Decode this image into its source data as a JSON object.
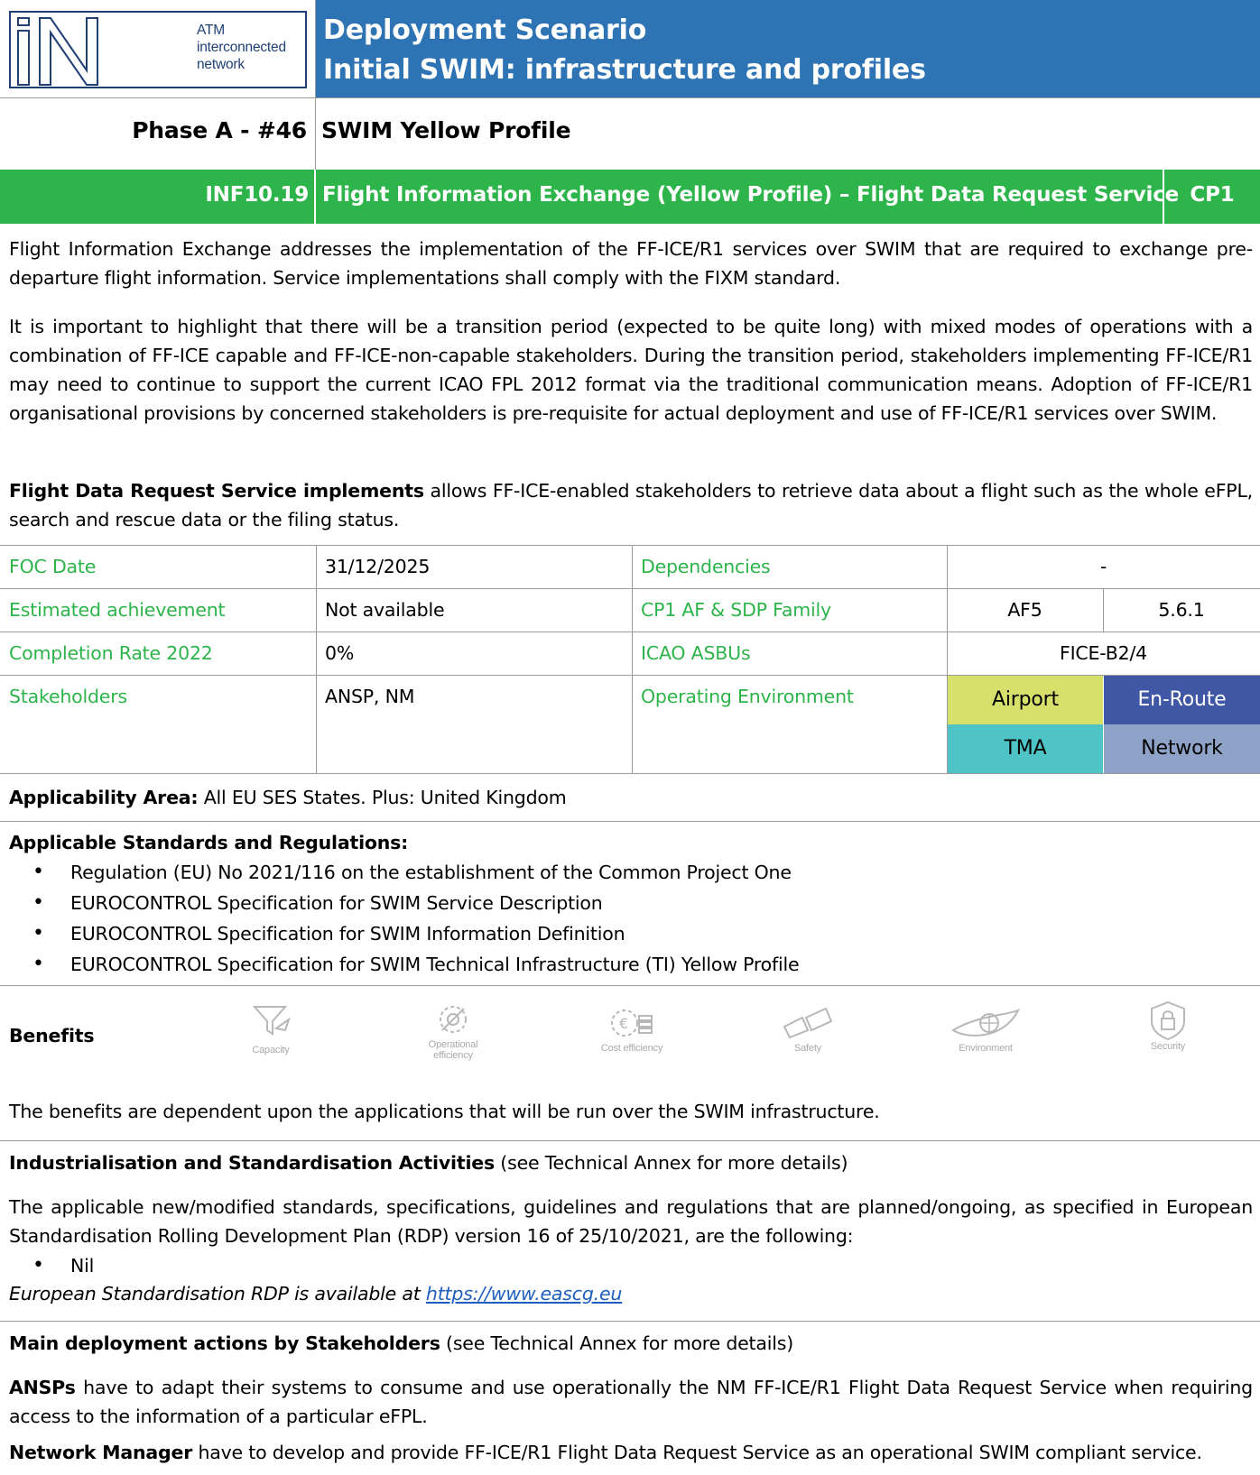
{
  "header": {
    "logo_letters": "iN",
    "logo_text": [
      "ATM",
      "interconnected",
      "network"
    ],
    "title_line1": "Deployment Scenario",
    "title_line2": "Initial SWIM: infrastructure and profiles"
  },
  "phase": {
    "left": "Phase A - #46",
    "right": "SWIM Yellow Profile"
  },
  "item": {
    "code": "INF10.19",
    "title": "Flight Information Exchange (Yellow Profile) – Flight Data Request Service",
    "cp": "CP1"
  },
  "description": {
    "p1": "Flight Information Exchange addresses the implementation of the FF-ICE/R1 services over SWIM that are required to exchange pre-departure flight information. Service implementations shall comply with the FIXM standard.",
    "p2": "It is important to highlight that there will be a transition period (expected to be quite long) with mixed modes of operations with a combination of FF-ICE capable and FF-ICE-non-capable stakeholders. During the transition period, stakeholders implementing FF-ICE/R1 may need to continue to support the current ICAO FPL 2012 format via the traditional communication means. Adoption of FF-ICE/R1 organisational provisions by concerned stakeholders is pre-requisite for actual deployment and use of FF-ICE/R1 services over SWIM.",
    "p3_bold": "Flight Data Request Service implements",
    "p3_rest": " allows FF-ICE-enabled stakeholders to retrieve data about a flight such as the whole eFPL, search and rescue data or the filing status."
  },
  "table": {
    "foc_label": "FOC Date",
    "foc_value": "31/12/2025",
    "dep_label": "Dependencies",
    "dep_value": "-",
    "est_label": "Estimated achievement",
    "est_value": "Not available",
    "cp1_label": "CP1 AF & SDP Family",
    "cp1_af": "AF5",
    "cp1_sdp": "5.6.1",
    "rate_label": "Completion Rate 2022",
    "rate_value": "0%",
    "icao_label": "ICAO ASBUs",
    "icao_value": "FICE-B2/4",
    "stake_label": "Stakeholders",
    "stake_value": "ANSP, NM",
    "env_label": "Operating Environment",
    "env": {
      "airport": "Airport",
      "enroute": "En-Route",
      "tma": "TMA",
      "network": "Network"
    }
  },
  "applicability": {
    "label": "Applicability Area:",
    "value": " All EU SES States. Plus: United Kingdom"
  },
  "standards": {
    "label": "Applicable Standards and Regulations:",
    "items": [
      "Regulation (EU) No 2021/116 on the establishment of the Common Project One",
      "EUROCONTROL Specification for SWIM Service Description",
      "EUROCONTROL Specification for SWIM Information Definition",
      "EUROCONTROL Specification for SWIM Technical Infrastructure (TI) Yellow Profile"
    ]
  },
  "benefits": {
    "label": "Benefits",
    "icons": {
      "capacity": "Capacity",
      "operational_1": "Operational",
      "operational_2": "efficiency",
      "cost": "Cost efficiency",
      "safety": "Safety",
      "environment": "Environment",
      "security": "Security"
    },
    "text": "The benefits are dependent upon the applications that will be run over the SWIM infrastructure."
  },
  "industrialisation": {
    "label": "Industrialisation and Standardisation Activities",
    "label_rest": " (see Technical Annex for more details)",
    "text": "The applicable new/modified standards, specifications, guidelines and regulations that are planned/ongoing, as specified in European Standardisation Rolling Development Plan (RDP) version 16 of 25/10/2021, are the following:",
    "item": "Nil",
    "rdp_text": "European Standardisation RDP is available at ",
    "rdp_link": "https://www.eascg.eu"
  },
  "actions": {
    "label": "Main deployment actions by Stakeholders",
    "label_rest": " (see Technical Annex for more details)",
    "ansp_bold": "ANSPs",
    "ansp_rest": " have to adapt their systems to consume and use operationally the NM FF-ICE/R1 Flight Data Request Service when requiring access to the information of a particular eFPL.",
    "nm_bold": "Network Manager",
    "nm_rest": " have to develop and provide FF-ICE/R1 Flight Data Request Service as an operational SWIM compliant service."
  },
  "colors": {
    "blue_band": "#2e74b5",
    "green_band": "#2db44a",
    "airport": "#d6e06b",
    "enroute": "#3f57a5",
    "tma": "#4ec4c6",
    "network": "#8ea3c7"
  }
}
